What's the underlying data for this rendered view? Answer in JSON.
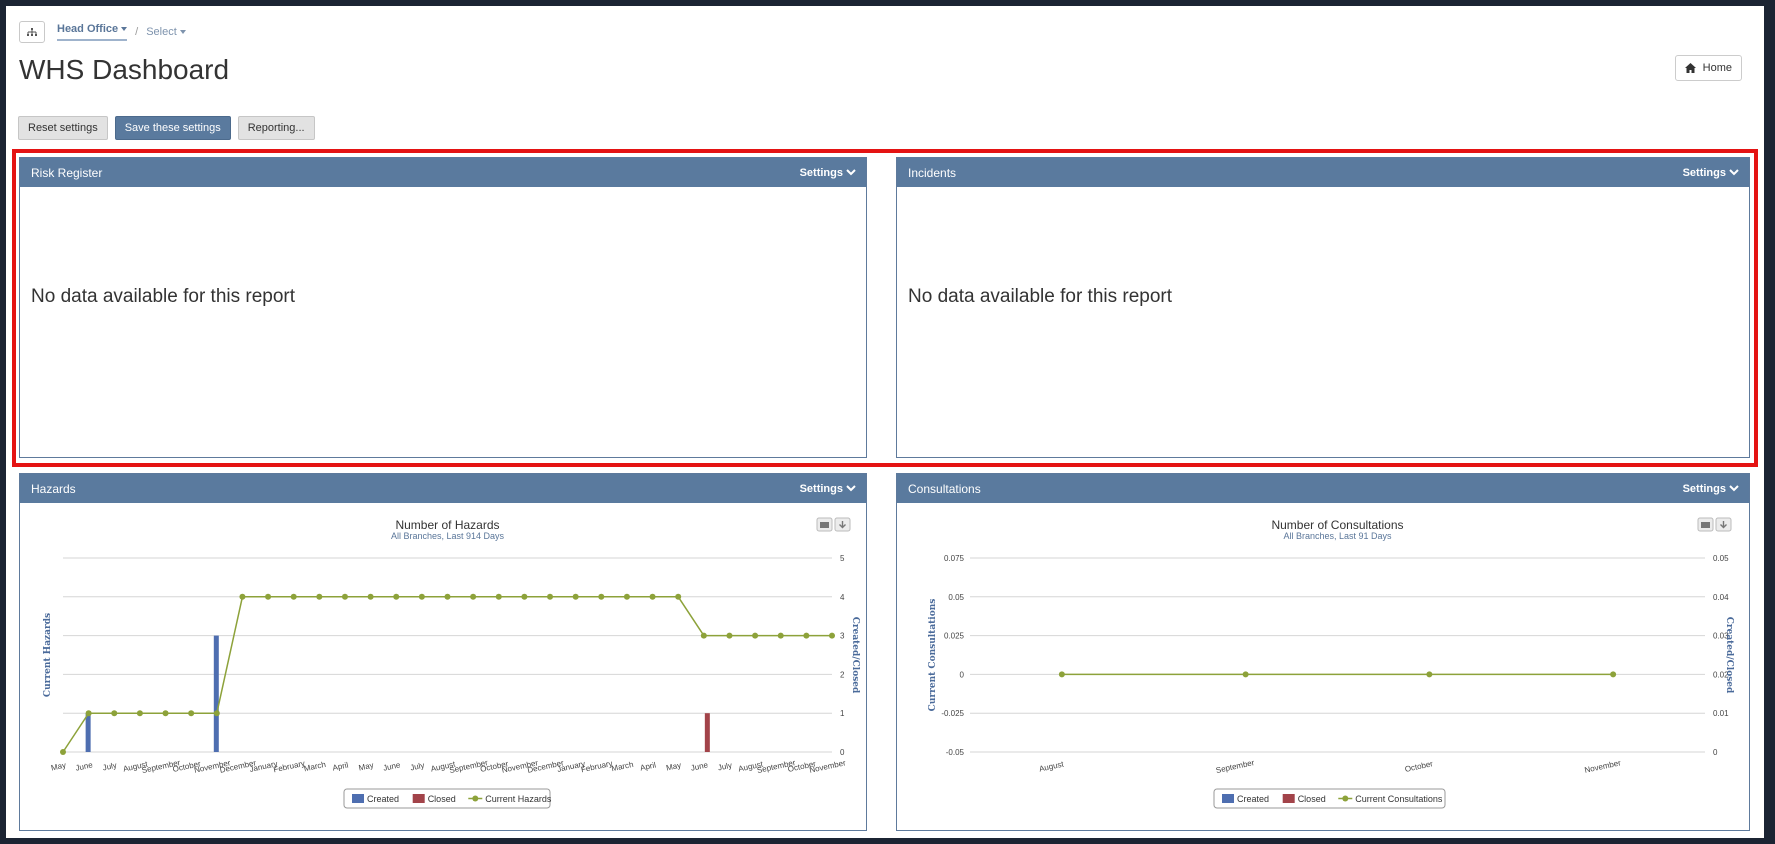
{
  "breadcrumb": {
    "org": "Head Office",
    "select": "Select"
  },
  "page": {
    "title": "WHS Dashboard",
    "home_label": "Home"
  },
  "buttons": {
    "reset": "Reset settings",
    "save": "Save these settings",
    "reporting": "Reporting..."
  },
  "colors": {
    "header": "#5a7a9e",
    "highlight": "#e41313",
    "created": "#4e6eb0",
    "closed": "#a24349",
    "current": "#8da23a"
  },
  "panels": {
    "risk": {
      "title": "Risk Register",
      "settings": "Settings",
      "nodata": "No data available for this report"
    },
    "incidents": {
      "title": "Incidents",
      "settings": "Settings",
      "nodata": "No data available for this report"
    },
    "hazards": {
      "title": "Hazards",
      "settings": "Settings"
    },
    "consultations": {
      "title": "Consultations",
      "settings": "Settings"
    }
  },
  "chart_data": [
    {
      "type": "bar+line",
      "title": "Number of Hazards",
      "subtitle": "All Branches, Last 914 Days",
      "ylabel_left": "Current Hazards",
      "ylabel_right": "Created/Closed",
      "categories": [
        "May",
        "June",
        "July",
        "August",
        "September",
        "October",
        "November",
        "December",
        "January",
        "February",
        "March",
        "April",
        "May",
        "June",
        "July",
        "August",
        "September",
        "October",
        "November",
        "December",
        "January",
        "February",
        "March",
        "April",
        "May",
        "June",
        "July",
        "August",
        "September",
        "October",
        "November"
      ],
      "ylim": [
        0,
        5
      ],
      "yticks": [
        0,
        1,
        2,
        3,
        4,
        5
      ],
      "yticks_right": [
        "0",
        "1",
        "2",
        "3",
        "4",
        "5"
      ],
      "series": [
        {
          "name": "Created",
          "kind": "bar",
          "values": [
            0,
            1,
            0,
            0,
            0,
            0,
            3,
            0,
            0,
            0,
            0,
            0,
            0,
            0,
            0,
            0,
            0,
            0,
            0,
            0,
            0,
            0,
            0,
            0,
            0,
            0,
            0,
            0,
            0,
            0,
            0
          ]
        },
        {
          "name": "Closed",
          "kind": "bar",
          "values": [
            0,
            0,
            0,
            0,
            0,
            0,
            0,
            0,
            0,
            0,
            0,
            0,
            0,
            0,
            0,
            0,
            0,
            0,
            0,
            0,
            0,
            0,
            0,
            0,
            0,
            1,
            0,
            0,
            0,
            0,
            0
          ]
        },
        {
          "name": "Current Hazards",
          "kind": "line",
          "values": [
            0,
            1,
            1,
            1,
            1,
            1,
            1,
            4,
            4,
            4,
            4,
            4,
            4,
            4,
            4,
            4,
            4,
            4,
            4,
            4,
            4,
            4,
            4,
            4,
            4,
            3,
            3,
            3,
            3,
            3,
            3
          ]
        }
      ],
      "legend": [
        "Created",
        "Closed",
        "Current Hazards"
      ],
      "legend_position": "bottom"
    },
    {
      "type": "bar+line",
      "title": "Number of Consultations",
      "subtitle": "All Branches, Last 91 Days",
      "ylabel_left": "Current Consultations",
      "ylabel_right": "Created/Closed",
      "categories": [
        "August",
        "September",
        "October",
        "November"
      ],
      "ylim": [
        -0.05,
        0.075
      ],
      "yticks": [
        -0.05,
        -0.025,
        0,
        0.025,
        0.05,
        0.075
      ],
      "yticks_left_labels": [
        "-0.05",
        "-0.025",
        "0",
        "0.025",
        "0.05",
        "0.075"
      ],
      "yticks_right": [
        "0",
        "0.01",
        "0.02",
        "0.03",
        "0.04",
        "0.05"
      ],
      "series": [
        {
          "name": "Created",
          "kind": "bar",
          "values": [
            0,
            0,
            0,
            0
          ]
        },
        {
          "name": "Closed",
          "kind": "bar",
          "values": [
            0,
            0,
            0,
            0
          ]
        },
        {
          "name": "Current Consultations",
          "kind": "line",
          "values": [
            0,
            0,
            0,
            0
          ]
        }
      ],
      "legend": [
        "Created",
        "Closed",
        "Current Consultations"
      ],
      "legend_position": "bottom"
    }
  ]
}
